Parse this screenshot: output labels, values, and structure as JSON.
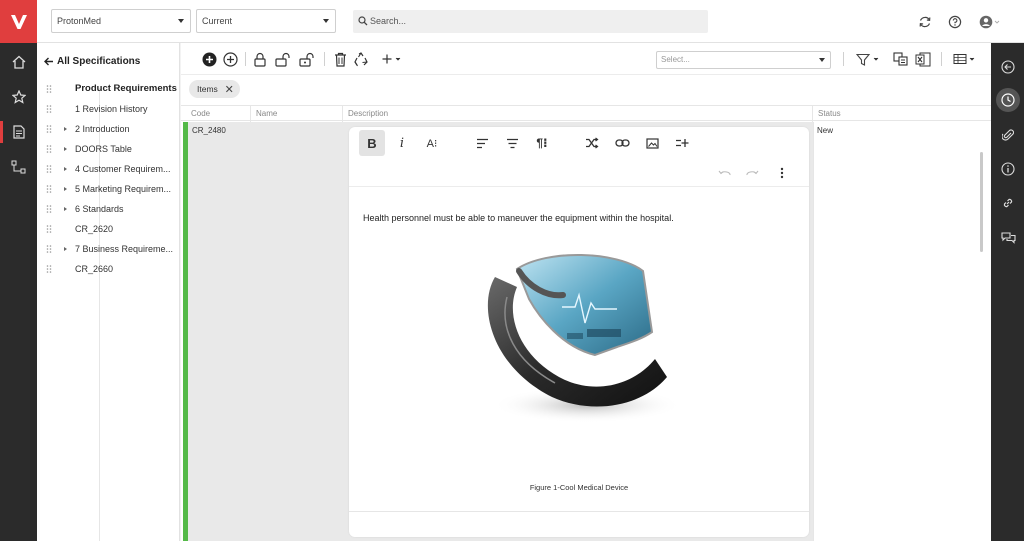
{
  "topbar": {
    "project_select": "ProtonMed",
    "version_select": "Current",
    "search_placeholder": "Search..."
  },
  "tree": {
    "back_label": "All Specifications",
    "title": "Product Requirements",
    "items": [
      {
        "label": "1  Revision History",
        "expandable": false
      },
      {
        "label": "2  Introduction",
        "expandable": true
      },
      {
        "label": "DOORS Table",
        "expandable": true
      },
      {
        "label": "4  Customer Requirem...",
        "expandable": true
      },
      {
        "label": "5  Marketing Requirem...",
        "expandable": true
      },
      {
        "label": "6  Standards",
        "expandable": true
      },
      {
        "label": "CR_2620",
        "expandable": false
      },
      {
        "label": "7  Business Requireme...",
        "expandable": true
      },
      {
        "label": "CR_2660",
        "expandable": false
      }
    ]
  },
  "toolbar": {
    "view_select_placeholder": "Select..."
  },
  "chip": {
    "label": "Items"
  },
  "grid": {
    "columns": [
      "Code",
      "Name",
      "Description",
      "Status"
    ],
    "row": {
      "code": "CR_2480",
      "status": "New"
    }
  },
  "editor": {
    "text": "Health personnel must be able to maneuver the equipment within the hospital.",
    "caption": "Figure 1-Cool Medical Device"
  },
  "colors": {
    "brand": "#e03e3e",
    "rail": "#2b2b2b",
    "accent_green": "#54b948"
  }
}
